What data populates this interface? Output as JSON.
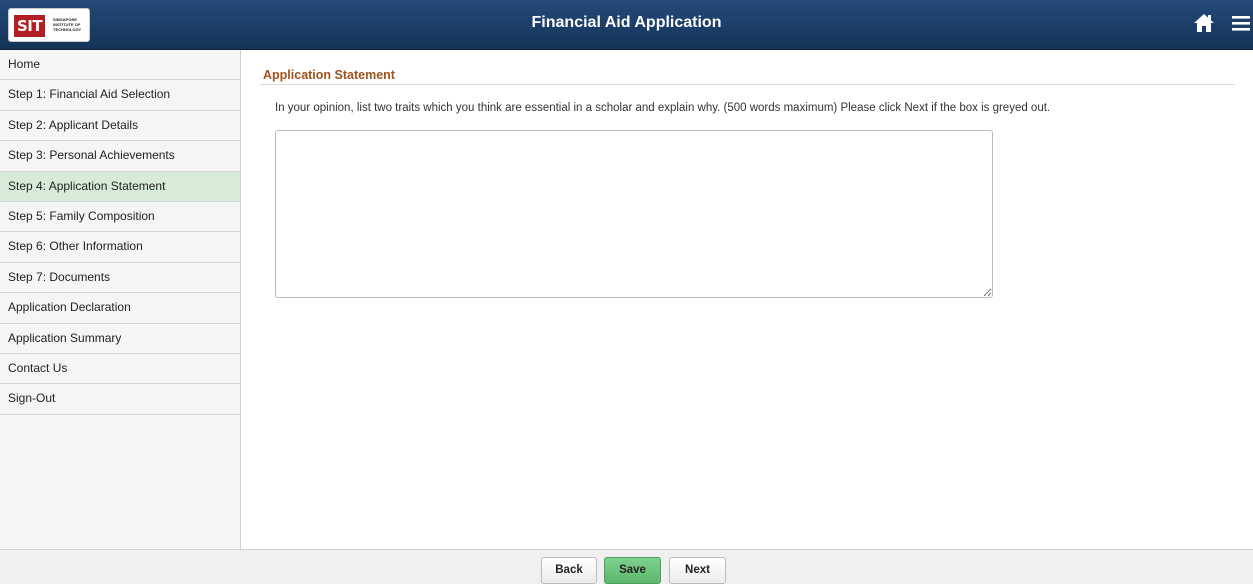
{
  "header": {
    "logo_mark": "SIT",
    "logo_text": "SINGAPORE INSTITUTE OF TECHNOLOGY",
    "title": "Financial Aid Application",
    "home_icon": "home-icon",
    "menu_icon": "hamburger-menu-icon",
    "background_color": "#1c3d66"
  },
  "sidebar": {
    "items": [
      {
        "label": "Home",
        "active": false
      },
      {
        "label": "Step 1: Financial Aid Selection",
        "active": false
      },
      {
        "label": "Step 2: Applicant Details",
        "active": false
      },
      {
        "label": "Step 3: Personal Achievements",
        "active": false
      },
      {
        "label": "Step 4: Application Statement",
        "active": true
      },
      {
        "label": "Step 5: Family Composition",
        "active": false
      },
      {
        "label": "Step 6: Other Information",
        "active": false
      },
      {
        "label": "Step 7: Documents",
        "active": false
      },
      {
        "label": "Application Declaration",
        "active": false
      },
      {
        "label": "Application Summary",
        "active": false
      },
      {
        "label": "Contact Us",
        "active": false
      },
      {
        "label": "Sign-Out",
        "active": false
      }
    ],
    "active_color": "#d6ecd9"
  },
  "main": {
    "section_title": "Application Statement",
    "instructions": "In your opinion, list two traits which you think are essential in a scholar and explain why. (500 words maximum) Please click Next if the box is greyed out.",
    "statement_value": "",
    "section_title_color": "#a0521d"
  },
  "footer": {
    "back_label": "Back",
    "save_label": "Save",
    "next_label": "Next",
    "save_color": "#6cc47c"
  }
}
